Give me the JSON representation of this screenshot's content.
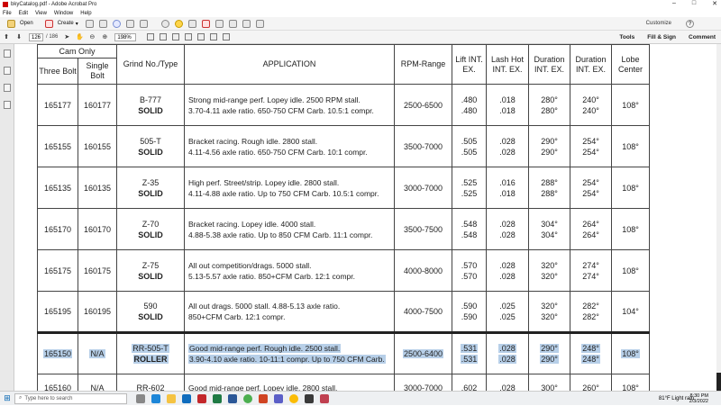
{
  "window": {
    "title": "bkyCatalog.pdf - Adobe Acrobat Pro"
  },
  "menu": [
    "File",
    "Edit",
    "View",
    "Window",
    "Help"
  ],
  "toolbar": {
    "open_label": "Open",
    "create_label": "Create",
    "customize_label": "Customize"
  },
  "nav": {
    "page": "126",
    "total": "/ 186",
    "zoom": "198%"
  },
  "right_tabs": [
    "Tools",
    "Fill & Sign",
    "Comment"
  ],
  "table": {
    "headers": {
      "cam_only": "Cam Only",
      "three_bolt": "Three Bolt",
      "single_bolt": "Single Bolt",
      "grind": "Grind No./Type",
      "application": "APPLICATION",
      "rpm": "RPM-Range",
      "lift": "Lift INT. EX.",
      "lash": "Lash Hot INT. EX.",
      "dur1": "Duration INT. EX.",
      "dur2": "Duration INT. EX.",
      "lobe": "Lobe Center"
    },
    "rows": [
      {
        "three": "165177",
        "single": "160177",
        "grind": "B-777",
        "type": "SOLID",
        "app1": "Strong mid-range perf. Lopey idle. 2500 RPM stall.",
        "app2": "3.70-4.11 axle ratio. 650-750 CFM Carb. 10.5:1 compr.",
        "rpm": "2500-6500",
        "lift1": ".480",
        "lift2": ".480",
        "lash1": ".018",
        "lash2": ".018",
        "d1a": "280°",
        "d1b": "280°",
        "d2a": "240°",
        "d2b": "240°",
        "lobe": "108°"
      },
      {
        "three": "165155",
        "single": "160155",
        "grind": "505-T",
        "type": "SOLID",
        "app1": "Bracket racing. Rough idle. 2800 stall.",
        "app2": "4.11-4.56 axle ratio. 650-750 CFM Carb. 10:1 compr.",
        "rpm": "3500-7000",
        "lift1": ".505",
        "lift2": ".505",
        "lash1": ".028",
        "lash2": ".028",
        "d1a": "290°",
        "d1b": "290°",
        "d2a": "254°",
        "d2b": "254°",
        "lobe": "108°"
      },
      {
        "three": "165135",
        "single": "160135",
        "grind": "Z-35",
        "type": "SOLID",
        "app1": "High perf. Street/strip. Lopey idle. 2800 stall.",
        "app2": "4.11-4.88 axle ratio. Up to 750 CFM Carb. 10.5:1 compr.",
        "rpm": "3000-7000",
        "lift1": ".525",
        "lift2": ".525",
        "lash1": ".016",
        "lash2": ".018",
        "d1a": "288°",
        "d1b": "288°",
        "d2a": "254°",
        "d2b": "254°",
        "lobe": "108°"
      },
      {
        "three": "165170",
        "single": "160170",
        "grind": "Z-70",
        "type": "SOLID",
        "app1": "Bracket racing. Lopey idle. 4000 stall.",
        "app2": "4.88-5.38 axle ratio. Up to 850 CFM Carb. 11:1 compr.",
        "rpm": "3500-7500",
        "lift1": ".548",
        "lift2": ".548",
        "lash1": ".028",
        "lash2": ".028",
        "d1a": "304°",
        "d1b": "304°",
        "d2a": "264°",
        "d2b": "264°",
        "lobe": "108°"
      },
      {
        "three": "165175",
        "single": "160175",
        "grind": "Z-75",
        "type": "SOLID",
        "app1": "All out competition/drags. 5000 stall.",
        "app2": "5.13-5.57 axle ratio. 850+CFM Carb. 12:1 compr.",
        "rpm": "4000-8000",
        "lift1": ".570",
        "lift2": ".570",
        "lash1": ".028",
        "lash2": ".028",
        "d1a": "320°",
        "d1b": "320°",
        "d2a": "274°",
        "d2b": "274°",
        "lobe": "108°"
      },
      {
        "three": "165195",
        "single": "160195",
        "grind": "590",
        "type": "SOLID",
        "app1": "All out drags. 5000 stall. 4.88-5.13 axle ratio.",
        "app2": "850+CFM Carb. 12:1 compr.",
        "rpm": "4000-7500",
        "lift1": ".590",
        "lift2": ".590",
        "lash1": ".025",
        "lash2": ".025",
        "d1a": "320°",
        "d1b": "320°",
        "d2a": "282°",
        "d2b": "282°",
        "lobe": "104°"
      },
      {
        "three": "165150",
        "single": "N/A",
        "grind": "RR-505-T",
        "type": "ROLLER",
        "app1": "Good mid-range perf. Rough idle. 2500 stall.",
        "app2": "3.90-4.10 axle ratio. 10-11:1 compr. Up to 750 CFM Carb.",
        "rpm": "2500-6400",
        "lift1": ".531",
        "lift2": ".531",
        "lash1": ".028",
        "lash2": ".028",
        "d1a": "290°",
        "d1b": "290°",
        "d2a": "248°",
        "d2b": "248°",
        "lobe": "108°"
      },
      {
        "three": "165160",
        "single": "N/A",
        "grind": "RR-602",
        "type": "",
        "app1": "Good mid-range perf. Lopey idle. 2800 stall.",
        "app2": "",
        "rpm": "3000-7000",
        "lift1": ".602",
        "lift2": "",
        "lash1": ".028",
        "lash2": "",
        "d1a": "300°",
        "d1b": "",
        "d2a": "260°",
        "d2b": "",
        "lobe": "108°"
      }
    ]
  },
  "taskbar": {
    "search_placeholder": "Type here to search",
    "weather": "81°F  Light rain",
    "time": "8:30 PM",
    "date": "2/3/2022"
  }
}
